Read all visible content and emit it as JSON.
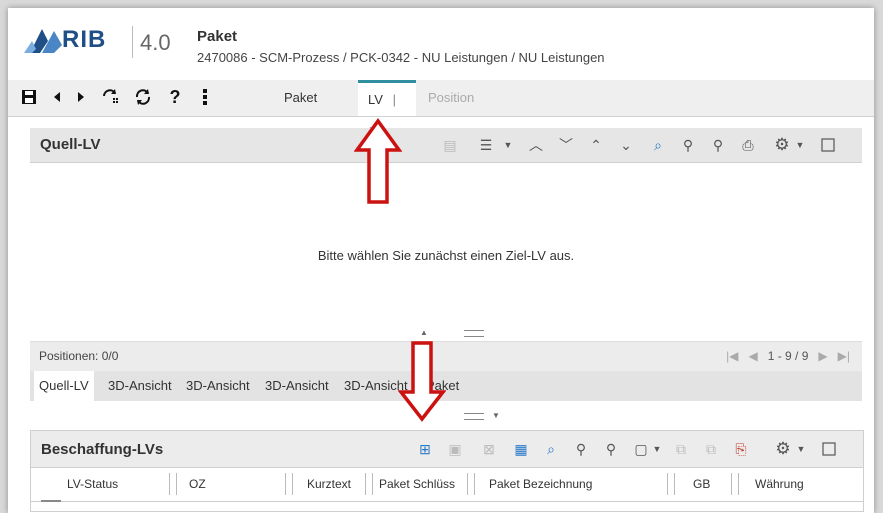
{
  "app": {
    "logo_text": "RIB",
    "version": "4.0",
    "module_title": "Paket",
    "breadcrumb": "2470086 - SCM-Prozess / PCK-0342 - NU Leistungen / NU Leistungen"
  },
  "toolbar": {
    "icons": [
      "save-icon",
      "previous-icon",
      "next-icon",
      "refresh-selection-icon",
      "refresh-icon",
      "help-icon",
      "more-vertical-icon"
    ],
    "tabs": [
      {
        "label": "Paket",
        "state": "normal"
      },
      {
        "label": "LV",
        "state": "active"
      },
      {
        "label": "⋮",
        "state": "menu"
      },
      {
        "label": "Position",
        "state": "disabled"
      }
    ]
  },
  "quell_lv": {
    "title": "Quell-LV",
    "empty_message": "Bitte wählen Sie zunächst einen Ziel-LV aus.",
    "status": "Positionen: 0/0",
    "pager": "1 - 9 / 9"
  },
  "bottom_tabs": [
    "Quell-LV",
    "3D-Ansicht",
    "3D-Ansicht",
    "3D-Ansicht",
    "3D-Ansicht",
    "Paket"
  ],
  "beschaffung": {
    "title": "Beschaffung-LVs",
    "columns": [
      "LV-Status",
      "OZ",
      "Kurztext",
      "Paket Schlüss",
      "Paket Bezeichnung",
      "GB",
      "Währung"
    ]
  },
  "colors": {
    "accent": "#2f8fa0",
    "logo_blue": "#1f4f86",
    "annotation_red": "#cc1111"
  }
}
